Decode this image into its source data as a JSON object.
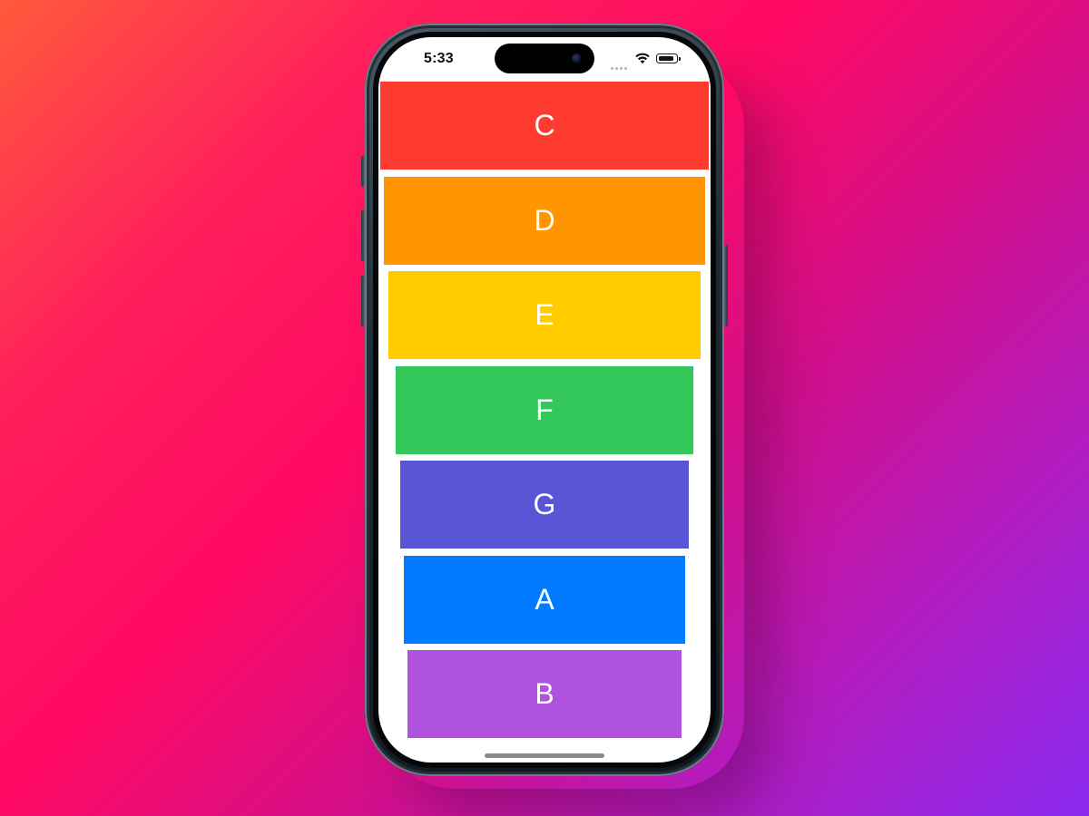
{
  "status_bar": {
    "time": "5:33",
    "icons": [
      "cellular-signal-icon",
      "wifi-icon",
      "battery-icon"
    ]
  },
  "list": {
    "items": [
      {
        "label": "C",
        "color": "#ff3b30"
      },
      {
        "label": "D",
        "color": "#ff9500"
      },
      {
        "label": "E",
        "color": "#ffcc00"
      },
      {
        "label": "F",
        "color": "#34c759"
      },
      {
        "label": "G",
        "color": "#5856d6"
      },
      {
        "label": "A",
        "color": "#007aff"
      },
      {
        "label": "B",
        "color": "#af52de"
      }
    ]
  }
}
